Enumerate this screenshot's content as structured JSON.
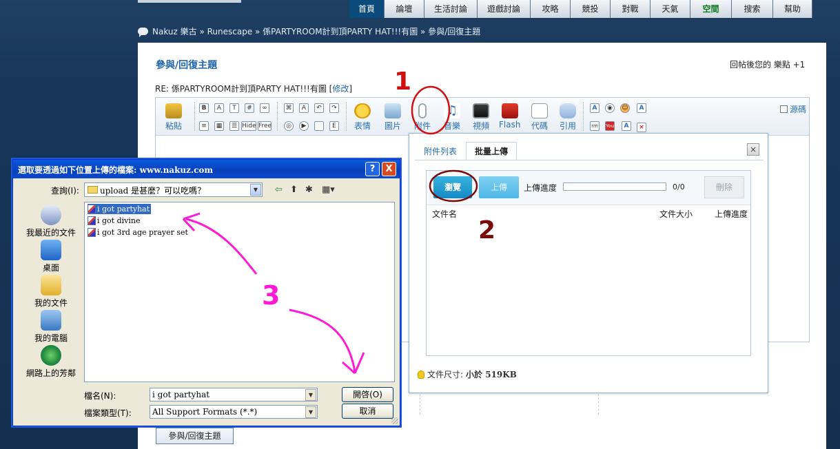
{
  "topnav": [
    "首頁",
    "論壇",
    "生活討論",
    "遊戲討論",
    "攻略",
    "競投",
    "對戰",
    "天氣",
    "空間",
    "搜索",
    "幫助"
  ],
  "breadcrumb": "Nakuz 樂古 » Runescape » 係PARTYROOM計到頂PARTY HAT!!!有圖 » 參與/回復主題",
  "page": {
    "title": "參與/回復主題",
    "bonus": "回帖後您的 樂點 +1",
    "subject": "RE: 係PARTYROOM計到頂PARTY HAT!!!有圖 [",
    "edit_link": "修改",
    "subject_end": "]",
    "submit": "參與/回復主題"
  },
  "toolbar": {
    "paste": "粘貼",
    "emoticon": "表情",
    "image": "圖片",
    "attachment": "附件",
    "music": "音樂",
    "video": "視頻",
    "flash": "Flash",
    "code": "代碼",
    "quote": "引用",
    "source": "源碼",
    "hide": "Hide",
    "free": "Free"
  },
  "upload": {
    "tab_list": "附件列表",
    "tab_batch": "批量上傳",
    "close": "×",
    "browse": "瀏覽",
    "upload": "上傳",
    "progress_label": "上傳進度",
    "progress_value": 0,
    "count": "0/0",
    "delete": "刪除",
    "col_name": "文件名",
    "col_size": "文件大小",
    "col_progress": "上傳進度",
    "size_label": "文件尺寸:",
    "size_value": "小於 519KB"
  },
  "dialog": {
    "title": "選取要透過如下位置上傳的檔案: www.nakuz.com",
    "help": "?",
    "close": "X",
    "lookin_label": "查詢(I):",
    "lookin_value": "upload 是甚麼？可以吃嗎？",
    "places": [
      "我最近的文件",
      "桌面",
      "我的文件",
      "我的電腦",
      "網路上的芳鄰"
    ],
    "files": [
      "i got partyhat",
      "i got divine",
      "i got 3rd age prayer set"
    ],
    "filename_label": "檔名(N):",
    "filename_value": "i got partyhat",
    "filetype_label": "檔案類型(T):",
    "filetype_value": "All Support Formats (*.*)",
    "open": "開啓(O)",
    "cancel": "取消"
  },
  "annotations": {
    "one": "1",
    "two": "2",
    "three": "3"
  },
  "colors": {
    "background": "#16304f",
    "nav_active": "#0a4b7c",
    "link": "#2266aa",
    "browse_button": "#1589c2",
    "annotation_red": "#d01010",
    "annotation_dark_red": "#7a0a0a",
    "annotation_magenta": "#ff1ad6"
  }
}
